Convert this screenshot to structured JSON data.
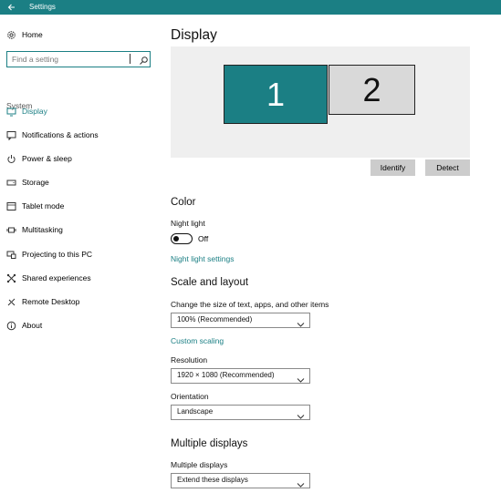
{
  "window": {
    "title": "Settings"
  },
  "sidebar": {
    "home_label": "Home",
    "search_placeholder": "Find a setting",
    "section_label": "System",
    "items": [
      {
        "label": "Display",
        "icon": "monitor-icon",
        "active": true
      },
      {
        "label": "Notifications & actions",
        "icon": "message-icon"
      },
      {
        "label": "Power & sleep",
        "icon": "power-icon"
      },
      {
        "label": "Storage",
        "icon": "storage-icon"
      },
      {
        "label": "Tablet mode",
        "icon": "tablet-icon"
      },
      {
        "label": "Multitasking",
        "icon": "multitasking-icon"
      },
      {
        "label": "Projecting to this PC",
        "icon": "projecting-icon"
      },
      {
        "label": "Shared experiences",
        "icon": "shared-icon"
      },
      {
        "label": "Remote Desktop",
        "icon": "remote-desktop-icon"
      },
      {
        "label": "About",
        "icon": "info-icon"
      }
    ]
  },
  "main": {
    "title": "Display",
    "monitors": [
      "1",
      "2"
    ],
    "identify_label": "Identify",
    "detect_label": "Detect",
    "color": {
      "heading": "Color",
      "night_light_label": "Night light",
      "night_light_state": "Off",
      "night_light_settings_link": "Night light settings"
    },
    "scale": {
      "heading": "Scale and layout",
      "size_label": "Change the size of text, apps, and other items",
      "size_value": "100% (Recommended)",
      "custom_scaling_link": "Custom scaling",
      "resolution_label": "Resolution",
      "resolution_value": "1920 × 1080 (Recommended)",
      "orientation_label": "Orientation",
      "orientation_value": "Landscape"
    },
    "multiple": {
      "heading": "Multiple displays",
      "label": "Multiple displays",
      "value": "Extend these displays"
    }
  },
  "colors": {
    "accent": "#1b7f84",
    "preview_bg": "#efefef",
    "button_bg": "#cccccc"
  }
}
